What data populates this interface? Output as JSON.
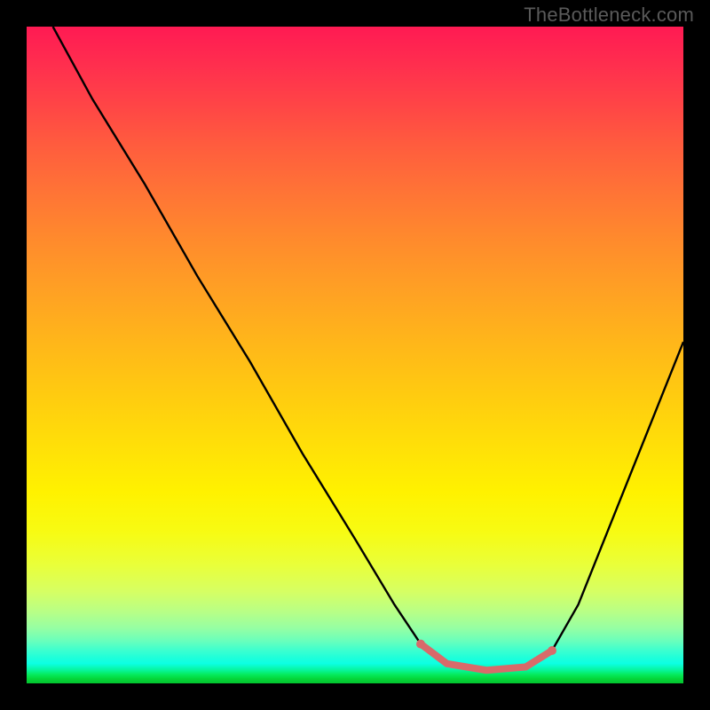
{
  "watermark": "TheBottleneck.com",
  "colors": {
    "highlight": "#d86a6a",
    "curve": "#000000"
  },
  "chart_data": {
    "type": "line",
    "title": "",
    "xlabel": "",
    "ylabel": "",
    "x_range": [
      0,
      100
    ],
    "y_range": [
      0,
      100
    ],
    "note": "Black curve plots bottleneck % (y, 0=bottom/green, 100=top/red) against some parameter x. Curve starts at (4,100), descends roughly linearly to a flat trough near y≈2 over x≈60–80, then rises toward (100,52). Salmon segment marks the low-bottleneck band (optimal range).",
    "curve_points": [
      {
        "x": 4,
        "y": 100
      },
      {
        "x": 10,
        "y": 89
      },
      {
        "x": 18,
        "y": 76
      },
      {
        "x": 26,
        "y": 62
      },
      {
        "x": 34,
        "y": 49
      },
      {
        "x": 42,
        "y": 35
      },
      {
        "x": 50,
        "y": 22
      },
      {
        "x": 56,
        "y": 12
      },
      {
        "x": 60,
        "y": 6
      },
      {
        "x": 64,
        "y": 3
      },
      {
        "x": 70,
        "y": 2
      },
      {
        "x": 76,
        "y": 2.5
      },
      {
        "x": 80,
        "y": 5
      },
      {
        "x": 84,
        "y": 12
      },
      {
        "x": 88,
        "y": 22
      },
      {
        "x": 92,
        "y": 32
      },
      {
        "x": 96,
        "y": 42
      },
      {
        "x": 100,
        "y": 52
      }
    ],
    "optimal_range": {
      "start": {
        "x": 60,
        "y": 6
      },
      "end": {
        "x": 80,
        "y": 5
      },
      "trough_points": [
        {
          "x": 60,
          "y": 6
        },
        {
          "x": 64,
          "y": 3
        },
        {
          "x": 70,
          "y": 2
        },
        {
          "x": 76,
          "y": 2.5
        },
        {
          "x": 80,
          "y": 5
        }
      ]
    }
  }
}
